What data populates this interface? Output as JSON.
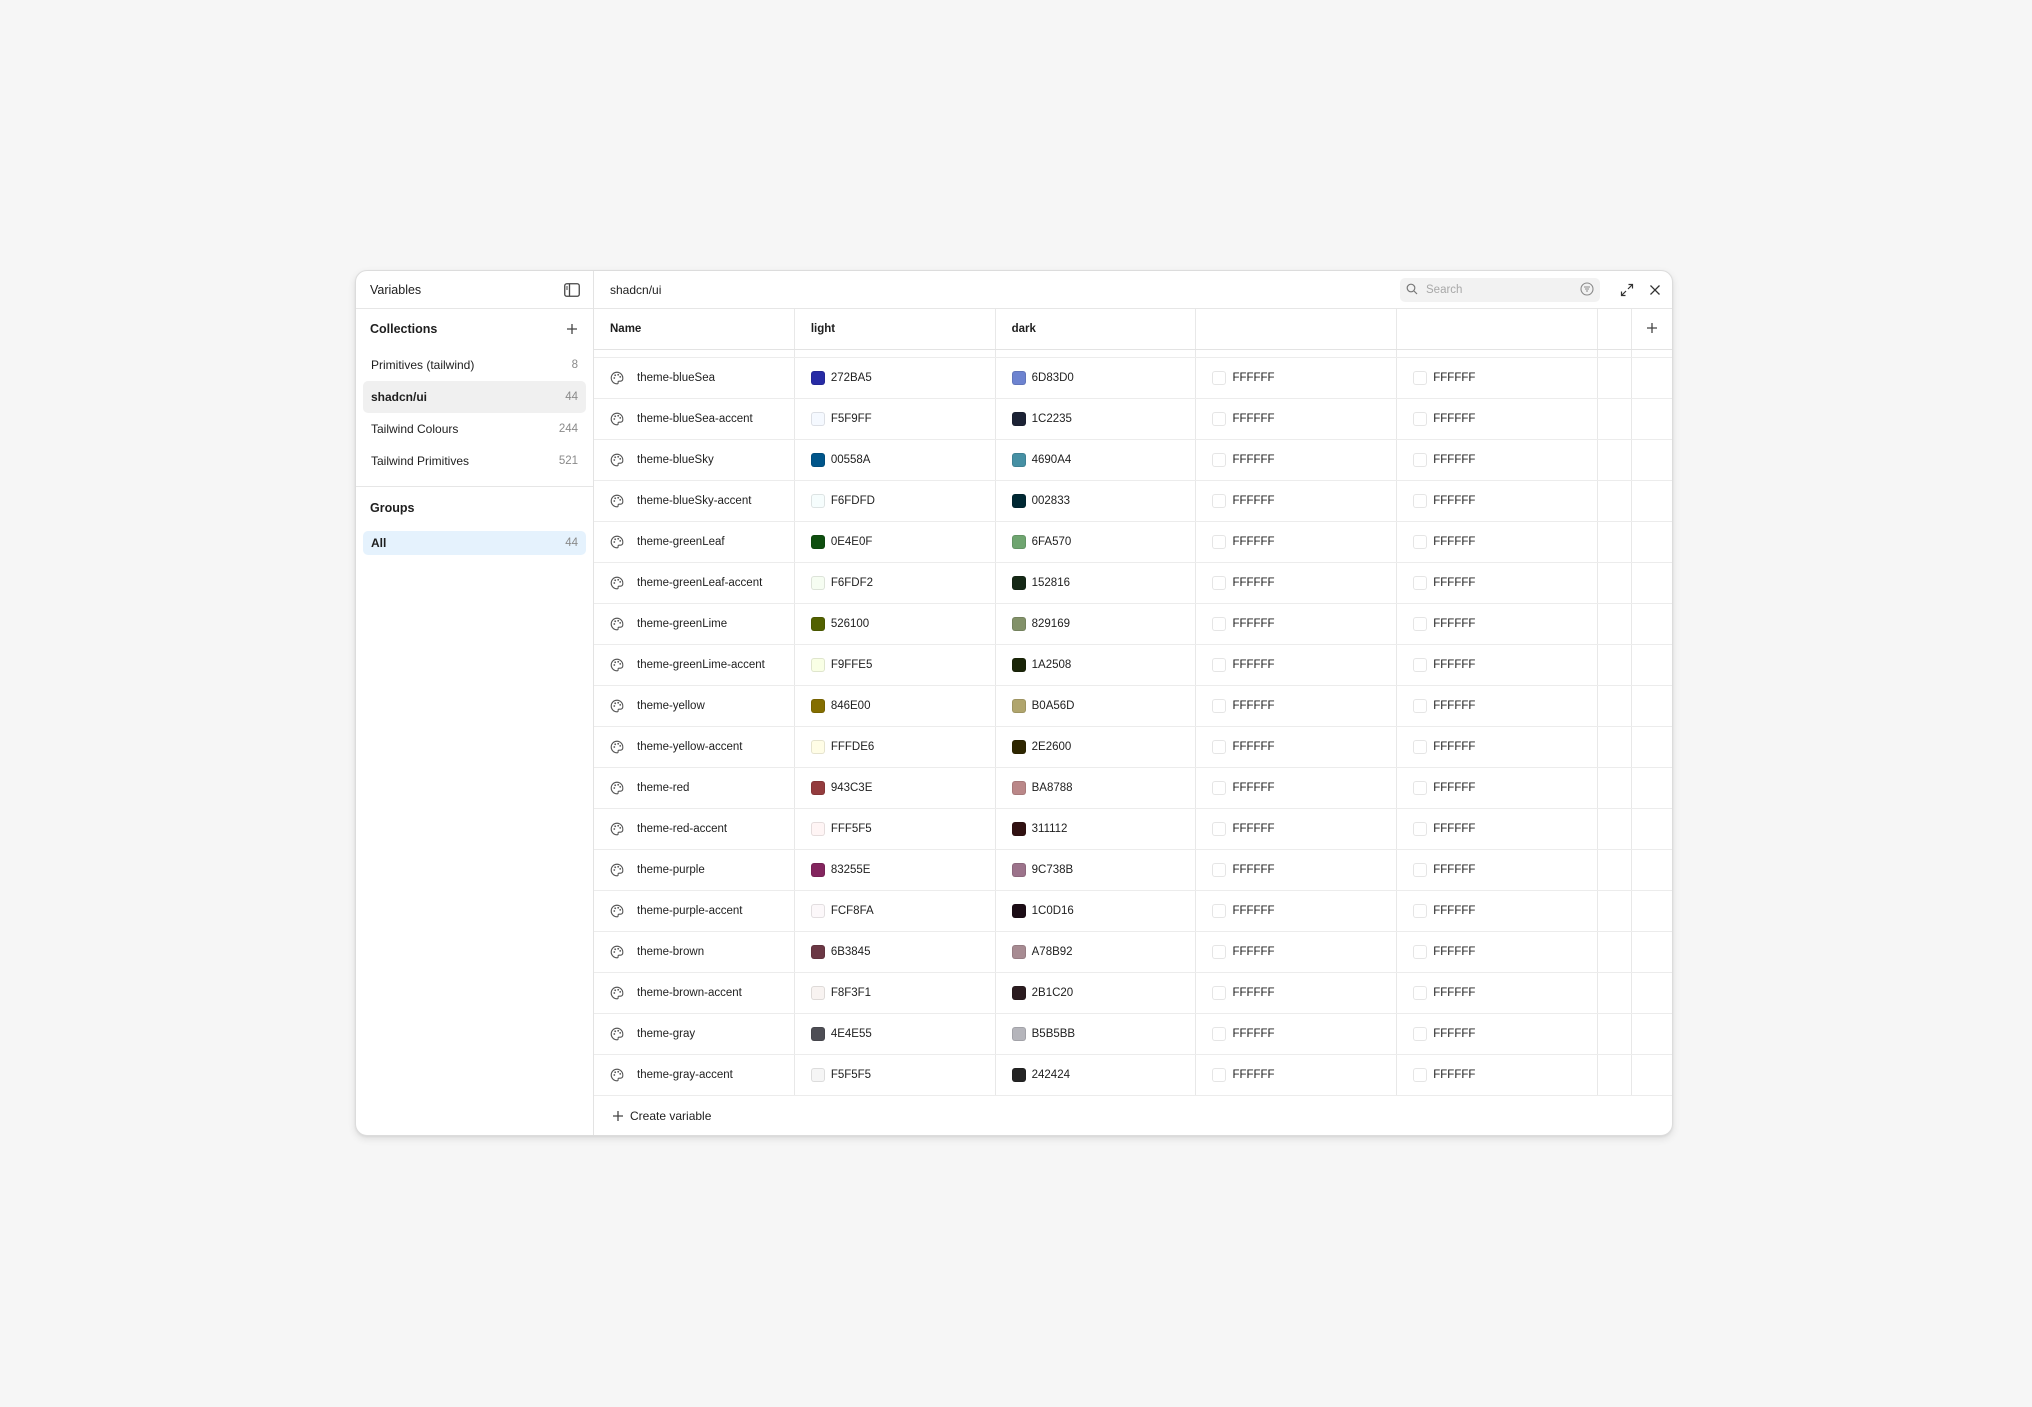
{
  "sidebar": {
    "title": "Variables",
    "collections_title": "Collections",
    "collections": [
      {
        "label": "Primitives (tailwind)",
        "count": "8"
      },
      {
        "label": "shadcn/ui",
        "count": "44"
      },
      {
        "label": "Tailwind Colours",
        "count": "244"
      },
      {
        "label": "Tailwind Primitives",
        "count": "521"
      }
    ],
    "groups_title": "Groups",
    "groups": [
      {
        "label": "All",
        "count": "44"
      }
    ]
  },
  "header": {
    "collection_name": "shadcn/ui",
    "search_placeholder": "Search"
  },
  "columns": {
    "name": "Name",
    "light": "light",
    "dark": "dark",
    "mode3": "",
    "mode4": ""
  },
  "rows": [
    {
      "name": "theme-blueSea",
      "light": "272BA5",
      "light_color": "#272BA5",
      "dark": "6D83D0",
      "dark_color": "#6D83D0",
      "m3": "FFFFFF",
      "m4": "FFFFFF"
    },
    {
      "name": "theme-blueSea-accent",
      "light": "F5F9FF",
      "light_color": "#F5F9FF",
      "dark": "1C2235",
      "dark_color": "#1C2235",
      "m3": "FFFFFF",
      "m4": "FFFFFF"
    },
    {
      "name": "theme-blueSky",
      "light": "00558A",
      "light_color": "#00558A",
      "dark": "4690A4",
      "dark_color": "#4690A4",
      "m3": "FFFFFF",
      "m4": "FFFFFF"
    },
    {
      "name": "theme-blueSky-accent",
      "light": "F6FDFD",
      "light_color": "#F6FDFD",
      "dark": "002833",
      "dark_color": "#002833",
      "m3": "FFFFFF",
      "m4": "FFFFFF"
    },
    {
      "name": "theme-greenLeaf",
      "light": "0E4E0F",
      "light_color": "#0E4E0F",
      "dark": "6FA570",
      "dark_color": "#6FA570",
      "m3": "FFFFFF",
      "m4": "FFFFFF"
    },
    {
      "name": "theme-greenLeaf-accent",
      "light": "F6FDF2",
      "light_color": "#F6FDF2",
      "dark": "152816",
      "dark_color": "#152816",
      "m3": "FFFFFF",
      "m4": "FFFFFF"
    },
    {
      "name": "theme-greenLime",
      "light": "526100",
      "light_color": "#526100",
      "dark": "829169",
      "dark_color": "#829169",
      "m3": "FFFFFF",
      "m4": "FFFFFF"
    },
    {
      "name": "theme-greenLime-accent",
      "light": "F9FFE5",
      "light_color": "#F9FFE5",
      "dark": "1A2508",
      "dark_color": "#1A2508",
      "m3": "FFFFFF",
      "m4": "FFFFFF"
    },
    {
      "name": "theme-yellow",
      "light": "846E00",
      "light_color": "#846E00",
      "dark": "B0A56D",
      "dark_color": "#B0A56D",
      "m3": "FFFFFF",
      "m4": "FFFFFF"
    },
    {
      "name": "theme-yellow-accent",
      "light": "FFFDE6",
      "light_color": "#FFFDE6",
      "dark": "2E2600",
      "dark_color": "#2E2600",
      "m3": "FFFFFF",
      "m4": "FFFFFF"
    },
    {
      "name": "theme-red",
      "light": "943C3E",
      "light_color": "#943C3E",
      "dark": "BA8788",
      "dark_color": "#BA8788",
      "m3": "FFFFFF",
      "m4": "FFFFFF"
    },
    {
      "name": "theme-red-accent",
      "light": "FFF5F5",
      "light_color": "#FFF5F5",
      "dark": "311112",
      "dark_color": "#311112",
      "m3": "FFFFFF",
      "m4": "FFFFFF"
    },
    {
      "name": "theme-purple",
      "light": "83255E",
      "light_color": "#83255E",
      "dark": "9C738B",
      "dark_color": "#9C738B",
      "m3": "FFFFFF",
      "m4": "FFFFFF"
    },
    {
      "name": "theme-purple-accent",
      "light": "FCF8FA",
      "light_color": "#FCF8FA",
      "dark": "1C0D16",
      "dark_color": "#1C0D16",
      "m3": "FFFFFF",
      "m4": "FFFFFF"
    },
    {
      "name": "theme-brown",
      "light": "6B3845",
      "light_color": "#6B3845",
      "dark": "A78B92",
      "dark_color": "#A78B92",
      "m3": "FFFFFF",
      "m4": "FFFFFF"
    },
    {
      "name": "theme-brown-accent",
      "light": "F8F3F1",
      "light_color": "#F8F3F1",
      "dark": "2B1C20",
      "dark_color": "#2B1C20",
      "m3": "FFFFFF",
      "m4": "FFFFFF"
    },
    {
      "name": "theme-gray",
      "light": "4E4E55",
      "light_color": "#4E4E55",
      "dark": "B5B5BB",
      "dark_color": "#B5B5BB",
      "m3": "FFFFFF",
      "m4": "FFFFFF"
    },
    {
      "name": "theme-gray-accent",
      "light": "F5F5F5",
      "light_color": "#F5F5F5",
      "dark": "242424",
      "dark_color": "#242424",
      "m3": "FFFFFF",
      "m4": "FFFFFF"
    }
  ],
  "footer": {
    "create_label": "Create variable"
  },
  "icons": {
    "sidebar_toggle": "sidebar-toggle-icon",
    "add": "plus-icon",
    "search": "search-icon",
    "filter": "filter-icon",
    "expand": "expand-icon",
    "close": "close-icon",
    "variable_type": "palette-icon"
  },
  "colors": {
    "selected_bg": "#f0f0f0",
    "active_bg": "#e5f2fd",
    "swatch_white": "#FFFFFF"
  }
}
